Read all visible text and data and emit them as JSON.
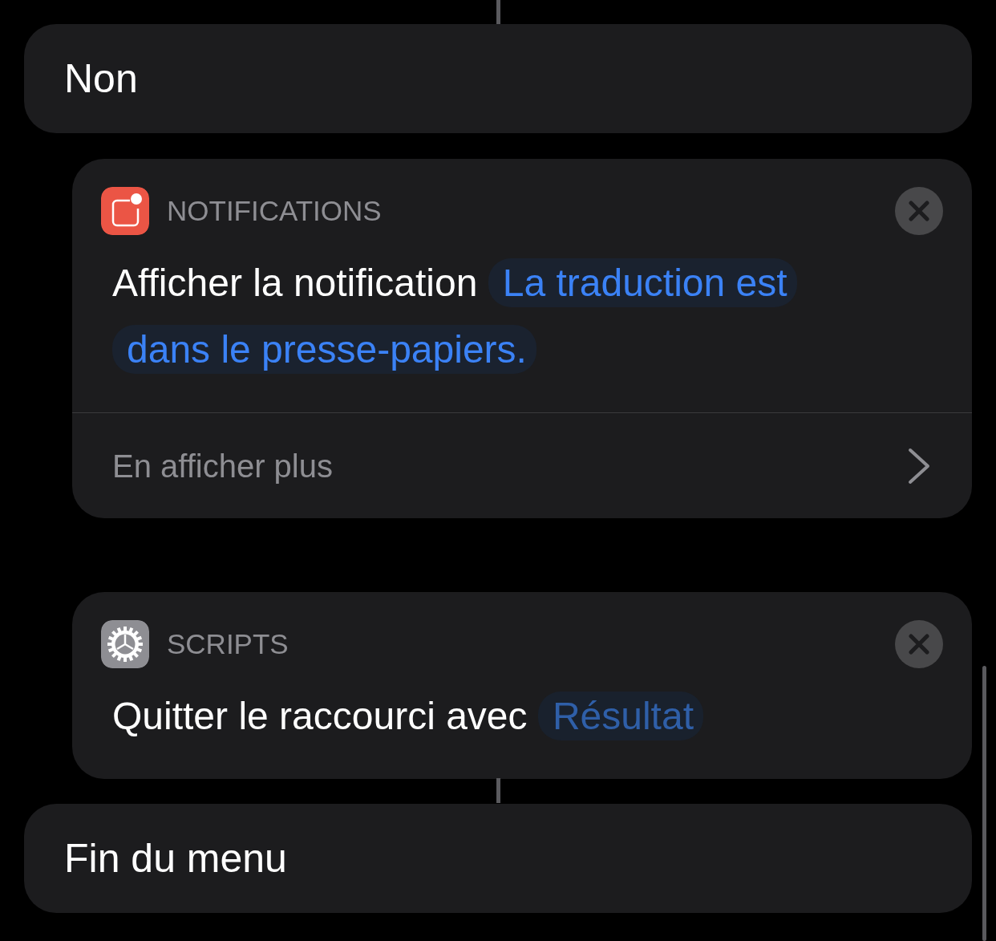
{
  "blocks": [
    {
      "kind": "control",
      "label": "Non"
    },
    {
      "kind": "action",
      "category": "NOTIFICATIONS",
      "text": "Afficher la notification",
      "token": {
        "kind": "text",
        "label": "La traduction est dans le presse-papiers."
      },
      "more": "En afficher plus"
    },
    {
      "kind": "action",
      "category": "SCRIPTS",
      "text": "Quitter le raccourci avec",
      "token": {
        "kind": "variable",
        "label": "Résultat"
      }
    },
    {
      "kind": "control",
      "label": "Fin du menu"
    }
  ]
}
